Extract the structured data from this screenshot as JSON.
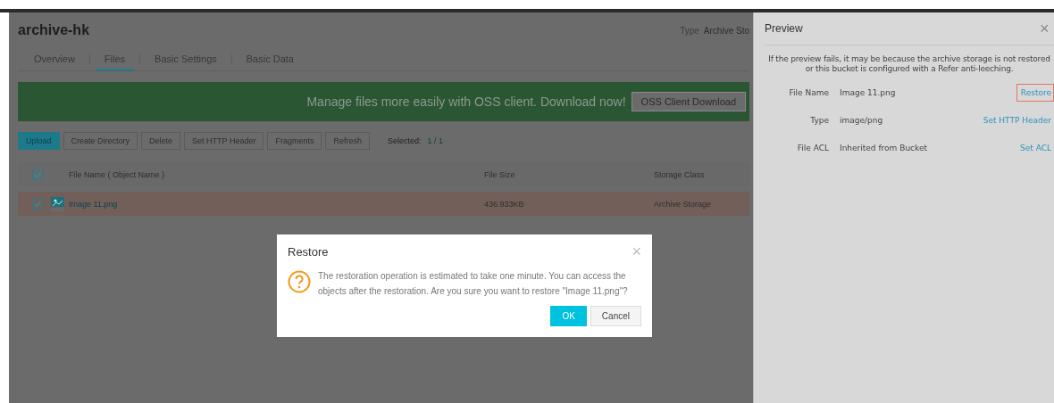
{
  "bucket": {
    "title": "archive-hk",
    "type_label": "Type",
    "type_value": "Archive Sto"
  },
  "tabs": [
    {
      "label": "Overview",
      "selected": false
    },
    {
      "label": "Files",
      "selected": true
    },
    {
      "label": "Basic Settings",
      "selected": false
    },
    {
      "label": "Basic Data",
      "selected": false
    }
  ],
  "banner": {
    "text": "Manage files more easily with OSS client. Download now!",
    "button": "OSS Client Download"
  },
  "toolbar": [
    {
      "label": "Upload",
      "kind": "primary"
    },
    {
      "label": "Create Directory",
      "kind": "default"
    },
    {
      "label": "Delete",
      "kind": "default"
    },
    {
      "label": "Set HTTP Header",
      "kind": "default"
    },
    {
      "label": "Fragments",
      "kind": "default"
    },
    {
      "label": "Refresh",
      "kind": "default"
    }
  ],
  "selection": {
    "label": "Selected:",
    "value": "1 / 1"
  },
  "table": {
    "all_checked": true,
    "columns": [
      "File Name ( Object Name )",
      "File Size",
      "Storage Class"
    ],
    "rows": [
      {
        "checked": true,
        "selected": true,
        "name": "Image 11.png",
        "size": "436.933KB",
        "storage_class": "Archive Storage"
      }
    ]
  },
  "preview": {
    "title": "Preview",
    "close": "×",
    "note": "If the preview fails, it may be because the archive storage is not restored or this bucket is configured with a Refer anti-leeching.",
    "fields": [
      {
        "label": "File Name",
        "value": "Image 11.png",
        "action": "Restore",
        "highlighted": true
      },
      {
        "label": "Type",
        "value": "image/png",
        "action": "Set HTTP Header",
        "highlighted": false
      },
      {
        "label": "File ACL",
        "value": "Inherited from Bucket",
        "action": "Set ACL",
        "highlighted": false
      }
    ]
  },
  "dialog": {
    "title": "Restore",
    "close": "×",
    "message": "The restoration operation is estimated to take one minute. You can access the objects after the restoration. Are you sure you want to restore \"Image 11.png\"?",
    "buttons": [
      {
        "label": "OK",
        "kind": "primary"
      },
      {
        "label": "Cancel",
        "kind": "default"
      }
    ]
  }
}
